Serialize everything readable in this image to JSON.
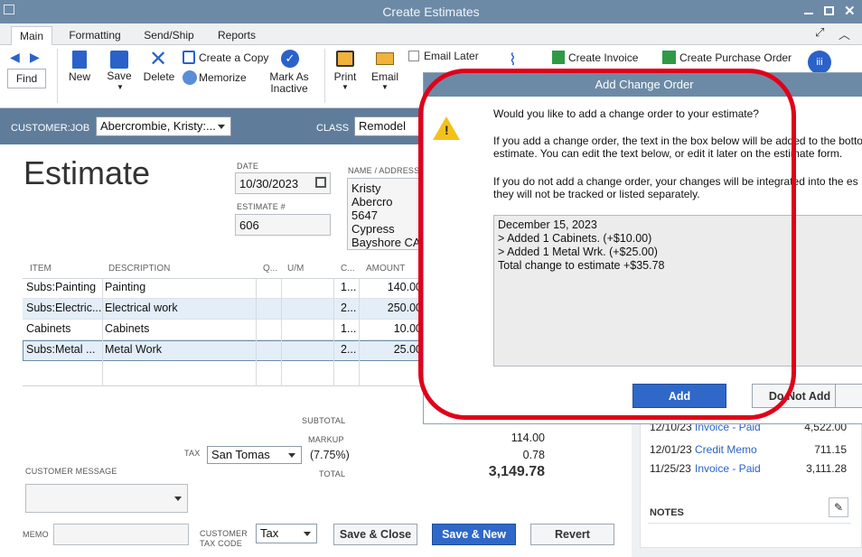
{
  "window": {
    "title": "Create Estimates"
  },
  "tabs": [
    "Main",
    "Formatting",
    "Send/Ship",
    "Reports"
  ],
  "ribbon": {
    "find": "Find",
    "new": "New",
    "save": "Save",
    "delete": "Delete",
    "create_copy": "Create a Copy",
    "memorize": "Memorize",
    "mark_as_inactive": "Mark As Inactive",
    "print": "Print",
    "email": "Email",
    "email_later": "Email Later",
    "create_invoice": "Create Invoice",
    "create_po": "Create Purchase Order"
  },
  "customer": {
    "label": "CUSTOMER:JOB",
    "value": "Abercrombie, Kristy:...",
    "class_label": "CLASS",
    "class_value": "Remodel"
  },
  "estimate": {
    "heading": "Estimate",
    "date_label": "DATE",
    "date": "10/30/2023",
    "number_label": "ESTIMATE #",
    "number": "606",
    "address_label": "NAME / ADDRESS",
    "address": [
      "Kristy Abercro",
      "5647 Cypress",
      "Bayshore CA"
    ]
  },
  "table": {
    "headers": [
      "ITEM",
      "DESCRIPTION",
      "Q...",
      "U/M",
      "C...",
      "AMOUNT"
    ],
    "rows": [
      {
        "item": "Subs:Painting",
        "desc": "Painting",
        "c": "1...",
        "amount": "140.00"
      },
      {
        "item": "Subs:Electric...",
        "desc": "Electrical work",
        "c": "2...",
        "amount": "250.00"
      },
      {
        "item": "Cabinets",
        "desc": "Cabinets",
        "c": "1...",
        "amount": "10.00"
      },
      {
        "item": "Subs:Metal ...",
        "desc": "Metal Work",
        "c": "2...",
        "amount": "25.00"
      }
    ]
  },
  "totals": {
    "subtotal_label": "SUBTOTAL",
    "markup_label": "MARKUP",
    "markup": "114.00",
    "tax_label": "TAX",
    "tax_item": "San Tomas",
    "tax_rate": "(7.75%)",
    "tax": "0.78",
    "total_label": "TOTAL",
    "total": "3,149.78"
  },
  "customer_message": {
    "label": "CUSTOMER MESSAGE"
  },
  "memo": {
    "label": "MEMO"
  },
  "customer_tax_code": {
    "label": "CUSTOMER TAX CODE",
    "value": "Tax"
  },
  "buttons": {
    "save_close": "Save & Close",
    "save_new": "Save & New",
    "revert": "Revert"
  },
  "history": [
    {
      "date": "12/10/23",
      "type": "Invoice - Paid",
      "amount": "4,522.00"
    },
    {
      "date": "12/01/23",
      "type": "Credit Memo",
      "amount": "711.15"
    },
    {
      "date": "11/25/23",
      "type": "Invoice - Paid",
      "amount": "3,111.28"
    }
  ],
  "notes_label": "NOTES",
  "dialog": {
    "title": "Add Change Order",
    "question": "Would you like to add a change order to your estimate?",
    "p1": "If you add a change order, the text in the box below will be added to the botto estimate.  You can edit the text below, or edit it later on the estimate form.",
    "p2": "If you do not add a change order, your changes will be integrated into the es they will not be tracked or listed separately.",
    "change_text": [
      "December 15, 2023",
      "> Added 1 Cabinets. (+$10.00)",
      "> Added 1 Metal Wrk. (+$25.00)",
      "Total change to estimate +$35.78"
    ],
    "add": "Add",
    "do_not_add": "Do Not Add"
  },
  "colors": {
    "titlebar": "#6c8aa6",
    "custbar": "#5f7d9b",
    "highlight": "#e0001a",
    "primary_button": "#2f68c8",
    "link": "#2a62c9"
  }
}
